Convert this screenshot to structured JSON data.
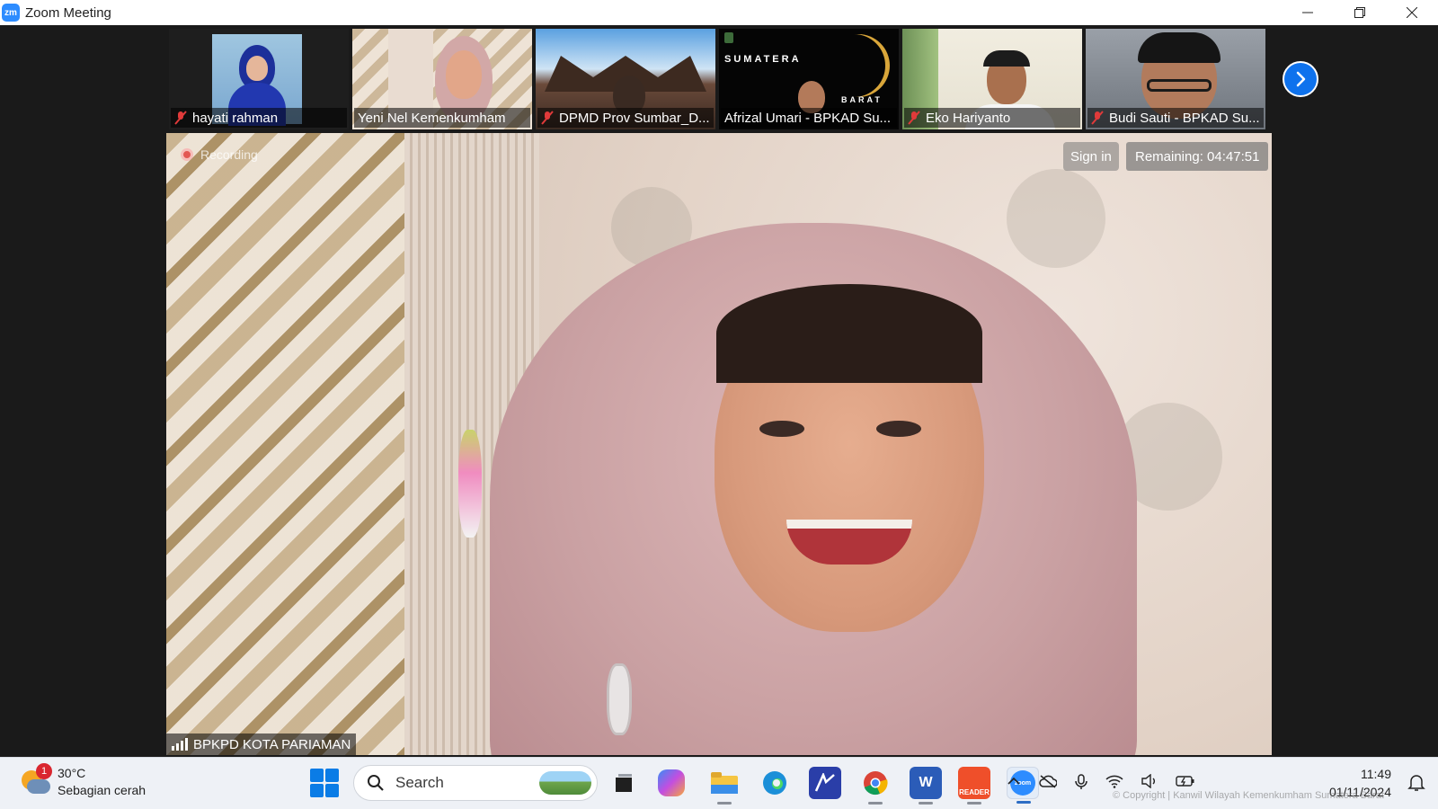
{
  "window": {
    "app_icon_text": "zm",
    "title": "Zoom Meeting",
    "controls": [
      "minimize",
      "restore",
      "close"
    ]
  },
  "thumbnails": [
    {
      "name": "hayati rahman",
      "muted": true
    },
    {
      "name": "Yeni Nel Kemenkumham",
      "muted": false
    },
    {
      "name": "DPMD Prov Sumbar_D...",
      "muted": true,
      "overlay_text": ""
    },
    {
      "name": "Afrizal Umari - BPKAD Su...",
      "muted": false,
      "overlay_text": "SUMATERA",
      "overlay_text_2": "BARAT"
    },
    {
      "name": "Eko Hariyanto",
      "muted": true
    },
    {
      "name": "Budi Sauti - BPKAD Su...",
      "muted": true
    }
  ],
  "main_video": {
    "recording_label": "Recording",
    "sign_in_label": "Sign in",
    "remaining_label": "Remaining: 04:47:51",
    "participant_name": "BPKPD KOTA PARIAMAN"
  },
  "taskbar": {
    "weather_temp": "30°C",
    "weather_desc": "Sebagian cerah",
    "weather_badge": "1",
    "search_placeholder": "Search",
    "zoom_app_label": "zoom",
    "reader_app_label": "READER",
    "time": "11:49",
    "date": "01/11/2024",
    "watermark": "© Copyright | Kanwil Wilayah Kemenkumham Sumatera Barat"
  },
  "colors": {
    "accent": "#0e72ed",
    "titlebar": "#ffffff",
    "background": "#1a1a1a",
    "taskbar": "#eef1f6"
  }
}
